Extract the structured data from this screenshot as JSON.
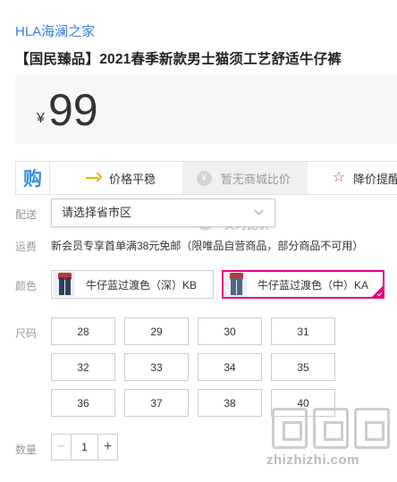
{
  "shop": {
    "name": "HLA海澜之家"
  },
  "product": {
    "title": "【国民臻品】2021春季新款男士猫须工艺舒适牛仔裤"
  },
  "price": {
    "currency": "¥",
    "amount": "99"
  },
  "promo": {
    "logo": "购",
    "items": [
      {
        "label": "价格平稳",
        "icon": "arrow-right-icon"
      },
      {
        "label": "暂无商城比价",
        "icon": "yen-icon"
      },
      {
        "label": "降价提醒",
        "icon": "star-icon"
      }
    ]
  },
  "delivery": {
    "label": "配送",
    "placeholder": "请选择省市区",
    "hidden_text": "实时比价"
  },
  "shipping": {
    "label": "运费",
    "text": "新会员专享首单满38元免邮（限唯品自营商品，部分商品不可用）"
  },
  "color": {
    "label": "颜色",
    "options": [
      {
        "name": "牛仔蓝过渡色（深）KB",
        "selected": false
      },
      {
        "name": "牛仔蓝过渡色（中）KA",
        "selected": true
      }
    ],
    "selected_border": "#e4007f"
  },
  "size": {
    "label": "尺码",
    "options": [
      "28",
      "29",
      "30",
      "31",
      "32",
      "33",
      "34",
      "35",
      "36",
      "37",
      "38",
      "40"
    ]
  },
  "quantity": {
    "label": "数量",
    "value": "1",
    "minus": "−",
    "plus": "+"
  },
  "watermark": {
    "text": "zhizhizhi.com"
  },
  "colors": {
    "link": "#3b7fd9",
    "accent": "#e4007f",
    "promo_blue": "#3a8ee6"
  }
}
